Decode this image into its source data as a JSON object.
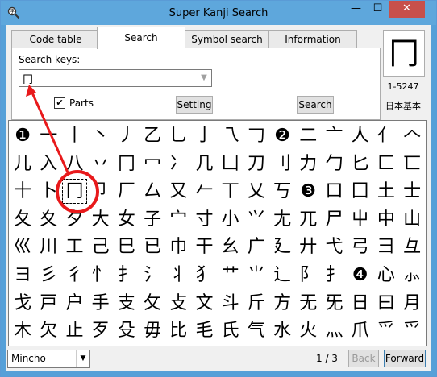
{
  "window": {
    "title": "Super Kanji Search",
    "app_icon": "magnifier-kanji-icon",
    "minimize_glyph": "—",
    "maximize_glyph": "☐",
    "close_glyph": "✕"
  },
  "tabs": [
    {
      "label": "Code table",
      "active": false
    },
    {
      "label": "Search",
      "active": true
    },
    {
      "label": "Symbol search",
      "active": false
    },
    {
      "label": "Information",
      "active": false
    }
  ],
  "search": {
    "keys_label": "Search keys:",
    "keys_value": "冂",
    "parts_label": "Parts",
    "parts_checked": true,
    "setting_button": "Setting",
    "search_button": "Search"
  },
  "preview": {
    "character": "冂",
    "code": "1-5247",
    "category": "日本基本"
  },
  "grid": {
    "rows": [
      [
        "❶",
        "一",
        "丨",
        "丶",
        "丿",
        "乙",
        "乚",
        "亅",
        "乁",
        "𠃌",
        "❷",
        "二",
        "亠",
        "人",
        "亻",
        "𠆢"
      ],
      [
        "儿",
        "入",
        "八",
        "丷",
        "冂",
        "冖",
        "冫",
        "几",
        "凵",
        "刀",
        "刂",
        "力",
        "勹",
        "匕",
        "匚",
        "匸"
      ],
      [
        "十",
        "卜",
        "冂",
        "卩",
        "厂",
        "厶",
        "又",
        "𠂉",
        "丅",
        "乂",
        "丂",
        "❸",
        "口",
        "囗",
        "土",
        "士"
      ],
      [
        "夂",
        "夊",
        "夕",
        "大",
        "女",
        "子",
        "宀",
        "寸",
        "小",
        "⺍",
        "尢",
        "兀",
        "尸",
        "屮",
        "中",
        "山"
      ],
      [
        "巛",
        "川",
        "工",
        "己",
        "巳",
        "已",
        "巾",
        "干",
        "幺",
        "广",
        "廴",
        "廾",
        "弋",
        "弓",
        "彐",
        "彑"
      ],
      [
        "ヨ",
        "彡",
        "彳",
        "忄",
        "扌",
        "氵",
        "丬",
        "犭",
        "艹",
        "⺌",
        "辶",
        "阝",
        "⺘",
        "❹",
        "心",
        "⺗"
      ],
      [
        "戈",
        "戸",
        "户",
        "手",
        "支",
        "攵",
        "攴",
        "文",
        "斗",
        "斤",
        "方",
        "无",
        "旡",
        "日",
        "曰",
        "月"
      ],
      [
        "木",
        "欠",
        "止",
        "歹",
        "殳",
        "毋",
        "比",
        "毛",
        "氏",
        "气",
        "水",
        "火",
        "灬",
        "爪",
        "爫",
        "⺤"
      ]
    ],
    "selected_char": "冂",
    "highlight_color": "#e8191b"
  },
  "footer": {
    "font_value": "Mincho",
    "page": "1 / 3",
    "back_button": "Back",
    "forward_button": "Forward"
  }
}
